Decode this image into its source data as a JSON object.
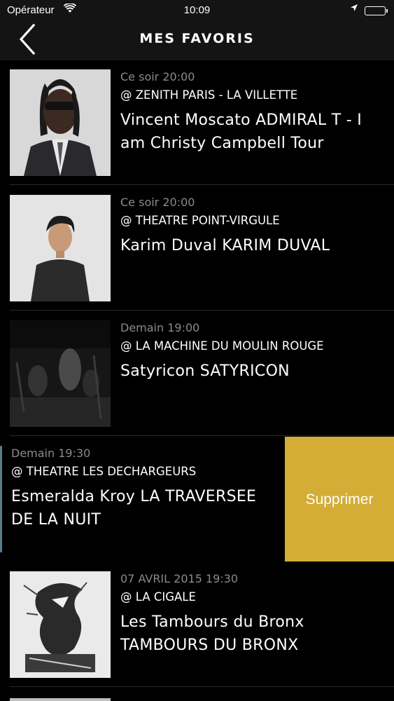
{
  "status_bar": {
    "carrier": "Opérateur",
    "time": "10:09",
    "battery_level": 1.0
  },
  "nav": {
    "title": "MES FAVORIS",
    "back_icon": "chevron-left-icon"
  },
  "events": [
    {
      "date": "Ce soir 20:00",
      "venue": "@ ZENITH PARIS - LA VILLETTE",
      "title": "Vincent Moscato ADMIRAL T - I am Christy Campbell Tour"
    },
    {
      "date": "Ce soir 20:00",
      "venue": "@ THEATRE POINT-VIRGULE",
      "title": "Karim Duval KARIM DUVAL"
    },
    {
      "date": "Demain 19:00",
      "venue": "@ LA MACHINE DU MOULIN ROUGE",
      "title": "Satyricon SATYRICON"
    },
    {
      "date": "Demain 19:30",
      "venue": "@ THEATRE LES DECHARGEURS",
      "title": "Esmeralda Kroy LA TRAVERSEE DE LA NUIT",
      "swiped": true,
      "delete_label": "Supprimer"
    },
    {
      "date": "07 AVRIL 2015 19:30",
      "venue": "@ LA CIGALE",
      "title": "Les Tambours du Bronx TAMBOURS DU BRONX"
    }
  ],
  "colors": {
    "background": "#000000",
    "bar": "#141414",
    "date_text": "#8a8a8a",
    "delete_button": "#d3ad35"
  }
}
